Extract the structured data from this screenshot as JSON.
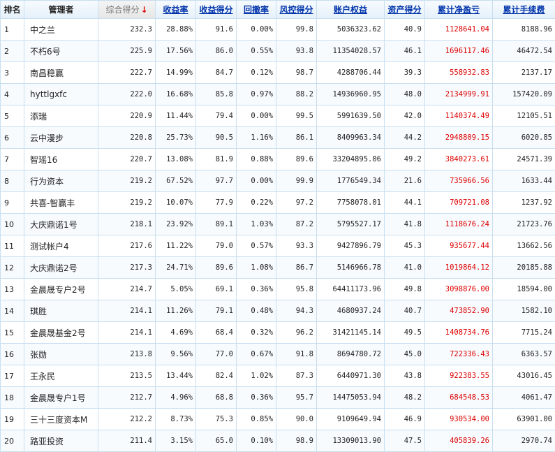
{
  "columns": {
    "rank": "排名",
    "manager": "管理者",
    "score": "综合得分",
    "score_arrow": "↓",
    "return_rate": "收益率",
    "return_score": "收益得分",
    "drawdown": "回撤率",
    "risk_score": "风控得分",
    "equity": "账户权益",
    "asset_score": "资产得分",
    "cum_profit": "累计净盈亏",
    "cum_fee": "累计手续费"
  },
  "colors": {
    "profit": "#dd0000",
    "link": "#0033aa",
    "border": "#c9dff0"
  },
  "rows": [
    {
      "rank": "1",
      "manager": "中之兰",
      "score": "232.3",
      "return_rate": "28.88%",
      "return_score": "91.6",
      "drawdown": "0.00%",
      "risk_score": "99.8",
      "equity": "5036323.62",
      "asset_score": "40.9",
      "cum_profit": "1128641.04",
      "cum_fee": "8188.96"
    },
    {
      "rank": "2",
      "manager": "不朽6号",
      "score": "225.9",
      "return_rate": "17.56%",
      "return_score": "86.0",
      "drawdown": "0.55%",
      "risk_score": "93.8",
      "equity": "11354028.57",
      "asset_score": "46.1",
      "cum_profit": "1696117.46",
      "cum_fee": "46472.54"
    },
    {
      "rank": "3",
      "manager": "南昌稳赢",
      "score": "222.7",
      "return_rate": "14.99%",
      "return_score": "84.7",
      "drawdown": "0.12%",
      "risk_score": "98.7",
      "equity": "4288706.44",
      "asset_score": "39.3",
      "cum_profit": "558932.83",
      "cum_fee": "2137.17"
    },
    {
      "rank": "4",
      "manager": "hyttlgxfc",
      "score": "222.0",
      "return_rate": "16.68%",
      "return_score": "85.8",
      "drawdown": "0.97%",
      "risk_score": "88.2",
      "equity": "14936960.95",
      "asset_score": "48.0",
      "cum_profit": "2134999.91",
      "cum_fee": "157420.09"
    },
    {
      "rank": "5",
      "manager": "添瑞",
      "score": "220.9",
      "return_rate": "11.44%",
      "return_score": "79.4",
      "drawdown": "0.00%",
      "risk_score": "99.5",
      "equity": "5991639.50",
      "asset_score": "42.0",
      "cum_profit": "1140374.49",
      "cum_fee": "12105.51"
    },
    {
      "rank": "6",
      "manager": "云中漫步",
      "score": "220.8",
      "return_rate": "25.73%",
      "return_score": "90.5",
      "drawdown": "1.16%",
      "risk_score": "86.1",
      "equity": "8409963.34",
      "asset_score": "44.2",
      "cum_profit": "2948809.15",
      "cum_fee": "6020.85"
    },
    {
      "rank": "7",
      "manager": "智瑶16",
      "score": "220.7",
      "return_rate": "13.08%",
      "return_score": "81.9",
      "drawdown": "0.88%",
      "risk_score": "89.6",
      "equity": "33204895.06",
      "asset_score": "49.2",
      "cum_profit": "3840273.61",
      "cum_fee": "24571.39"
    },
    {
      "rank": "8",
      "manager": "行为资本",
      "score": "219.2",
      "return_rate": "67.52%",
      "return_score": "97.7",
      "drawdown": "0.00%",
      "risk_score": "99.9",
      "equity": "1776549.34",
      "asset_score": "21.6",
      "cum_profit": "735966.56",
      "cum_fee": "1633.44"
    },
    {
      "rank": "9",
      "manager": "共喜-智赢丰",
      "score": "219.2",
      "return_rate": "10.07%",
      "return_score": "77.9",
      "drawdown": "0.22%",
      "risk_score": "97.2",
      "equity": "7758078.01",
      "asset_score": "44.1",
      "cum_profit": "709721.08",
      "cum_fee": "1237.92"
    },
    {
      "rank": "10",
      "manager": "大庆鼎诺1号",
      "score": "218.1",
      "return_rate": "23.92%",
      "return_score": "89.1",
      "drawdown": "1.03%",
      "risk_score": "87.2",
      "equity": "5795527.17",
      "asset_score": "41.8",
      "cum_profit": "1118676.24",
      "cum_fee": "21723.76"
    },
    {
      "rank": "11",
      "manager": "测试帐户4",
      "score": "217.6",
      "return_rate": "11.22%",
      "return_score": "79.0",
      "drawdown": "0.57%",
      "risk_score": "93.3",
      "equity": "9427896.79",
      "asset_score": "45.3",
      "cum_profit": "935677.44",
      "cum_fee": "13662.56"
    },
    {
      "rank": "12",
      "manager": "大庆鼎诺2号",
      "score": "217.3",
      "return_rate": "24.71%",
      "return_score": "89.6",
      "drawdown": "1.08%",
      "risk_score": "86.7",
      "equity": "5146966.78",
      "asset_score": "41.0",
      "cum_profit": "1019864.12",
      "cum_fee": "20185.88"
    },
    {
      "rank": "13",
      "manager": "金晨晟专户2号",
      "score": "214.7",
      "return_rate": "5.05%",
      "return_score": "69.1",
      "drawdown": "0.36%",
      "risk_score": "95.8",
      "equity": "64411173.96",
      "asset_score": "49.8",
      "cum_profit": "3098876.00",
      "cum_fee": "18594.00"
    },
    {
      "rank": "14",
      "manager": "琪胜",
      "score": "214.1",
      "return_rate": "11.26%",
      "return_score": "79.1",
      "drawdown": "0.48%",
      "risk_score": "94.3",
      "equity": "4680937.24",
      "asset_score": "40.7",
      "cum_profit": "473852.90",
      "cum_fee": "1582.10"
    },
    {
      "rank": "15",
      "manager": "金晨晟基金2号",
      "score": "214.1",
      "return_rate": "4.69%",
      "return_score": "68.4",
      "drawdown": "0.32%",
      "risk_score": "96.2",
      "equity": "31421145.14",
      "asset_score": "49.5",
      "cum_profit": "1408734.76",
      "cum_fee": "7715.24"
    },
    {
      "rank": "16",
      "manager": "张勋",
      "score": "213.8",
      "return_rate": "9.56%",
      "return_score": "77.0",
      "drawdown": "0.67%",
      "risk_score": "91.8",
      "equity": "8694780.72",
      "asset_score": "45.0",
      "cum_profit": "722336.43",
      "cum_fee": "6363.57"
    },
    {
      "rank": "17",
      "manager": "王永民",
      "score": "213.5",
      "return_rate": "13.44%",
      "return_score": "82.4",
      "drawdown": "1.02%",
      "risk_score": "87.3",
      "equity": "6440971.30",
      "asset_score": "43.8",
      "cum_profit": "922383.55",
      "cum_fee": "43016.45"
    },
    {
      "rank": "18",
      "manager": "金晨晟专户1号",
      "score": "212.7",
      "return_rate": "4.96%",
      "return_score": "68.8",
      "drawdown": "0.36%",
      "risk_score": "95.7",
      "equity": "14475053.94",
      "asset_score": "48.2",
      "cum_profit": "684548.53",
      "cum_fee": "4061.47"
    },
    {
      "rank": "19",
      "manager": "三十三度资本M",
      "score": "212.2",
      "return_rate": "8.73%",
      "return_score": "75.3",
      "drawdown": "0.85%",
      "risk_score": "90.0",
      "equity": "9109649.94",
      "asset_score": "46.9",
      "cum_profit": "930534.00",
      "cum_fee": "63901.00"
    },
    {
      "rank": "20",
      "manager": "路亚投资",
      "score": "211.4",
      "return_rate": "3.15%",
      "return_score": "65.0",
      "drawdown": "0.10%",
      "risk_score": "98.9",
      "equity": "13309013.90",
      "asset_score": "47.5",
      "cum_profit": "405839.26",
      "cum_fee": "2970.74"
    }
  ]
}
